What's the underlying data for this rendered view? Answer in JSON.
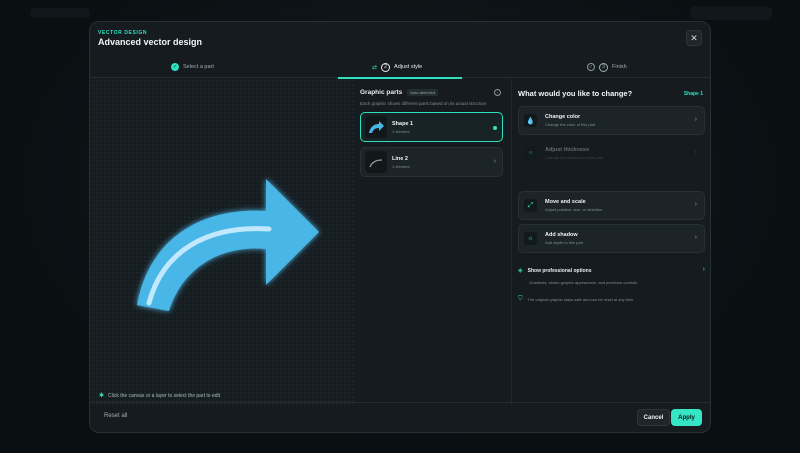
{
  "modal": {
    "eyebrow": "VECTOR DESIGN",
    "title": "Advanced vector design",
    "close_icon": "close-icon"
  },
  "steps": [
    {
      "label": "Select a part",
      "state": "done",
      "icon": "check-icon"
    },
    {
      "label": "Adjust style",
      "number": "2",
      "state": "active"
    },
    {
      "label": "Finish",
      "number": "3",
      "state": "upcoming"
    }
  ],
  "canvas": {
    "hint": "Click the canvas or a layer to select the part to edit",
    "arrow_color": "#49b6e8"
  },
  "parts": {
    "title": "Graphic parts",
    "badge": "Auto-detected",
    "subtitle": "Each graphic shows different parts based on its actual structure",
    "items": [
      {
        "name": "Shape 1",
        "count": "1 element",
        "selected": true
      },
      {
        "name": "Line 2",
        "count": "1 element",
        "selected": false
      }
    ]
  },
  "options": {
    "title": "What would you like to change?",
    "target": "Shape 1",
    "items": [
      {
        "name": "Change color",
        "desc": "Change the color of this part",
        "icon": "droplet-icon",
        "disabled": false
      },
      {
        "name": "Adjust thickness",
        "desc": "Change the thickness of this part",
        "icon": "thickness-icon",
        "disabled": true
      },
      {
        "name": "Move and scale",
        "desc": "Adjust position, size, or direction",
        "icon": "move-icon",
        "disabled": false
      },
      {
        "name": "Add shadow",
        "desc": "Add depth to this part",
        "icon": "sun-icon",
        "disabled": false
      }
    ],
    "pro_label": "Show professional options",
    "pro_desc": "Gradients, stroke-graphic appearance, and precision controls",
    "safe_note": "The original graphic stays safe and can be reset at any time"
  },
  "footer": {
    "reset": "Reset all",
    "cancel": "Cancel",
    "apply": "Apply"
  },
  "colors": {
    "accent": "#2ee0c0",
    "background": "#151b1f"
  }
}
